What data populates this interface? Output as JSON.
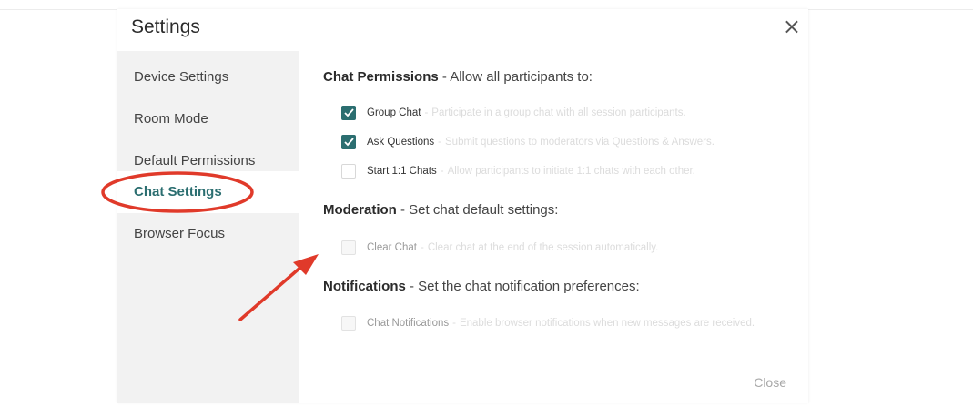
{
  "dialog": {
    "title": "Settings",
    "close_glyph": "×",
    "footer_close": "Close"
  },
  "sidebar": {
    "items": [
      {
        "label": "Device Settings",
        "active": false
      },
      {
        "label": "Room Mode",
        "active": false
      },
      {
        "label": "Default Permissions",
        "active": false
      },
      {
        "label": "Chat Settings",
        "active": true
      },
      {
        "label": "Browser Focus",
        "active": false
      }
    ]
  },
  "sections": {
    "permissions": {
      "title": "Chat Permissions",
      "subtitle": " - Allow all participants to:",
      "options": [
        {
          "label": "Group Chat",
          "desc": "Participate in a group chat with all session participants.",
          "checked": true
        },
        {
          "label": "Ask Questions",
          "desc": "Submit questions to moderators via Questions & Answers.",
          "checked": true
        },
        {
          "label": "Start 1:1 Chats",
          "desc": "Allow participants to initiate 1:1 chats with each other.",
          "checked": false
        }
      ]
    },
    "moderation": {
      "title": "Moderation",
      "subtitle": " - Set chat default settings:",
      "options": [
        {
          "label": "Clear Chat",
          "desc": "Clear chat at the end of the session automatically.",
          "checked": false
        }
      ]
    },
    "notifications": {
      "title": "Notifications",
      "subtitle": " - Set the chat notification preferences:",
      "options": [
        {
          "label": "Chat Notifications",
          "desc": "Enable browser notifications when new messages are received.",
          "checked": false
        }
      ]
    }
  },
  "separator": "-",
  "colors": {
    "accent": "#2b6e70",
    "annotation": "#e03a2a",
    "sidebar_bg": "#f2f2f2"
  },
  "icons": {
    "check": "checkmark-icon",
    "close": "close-icon"
  }
}
